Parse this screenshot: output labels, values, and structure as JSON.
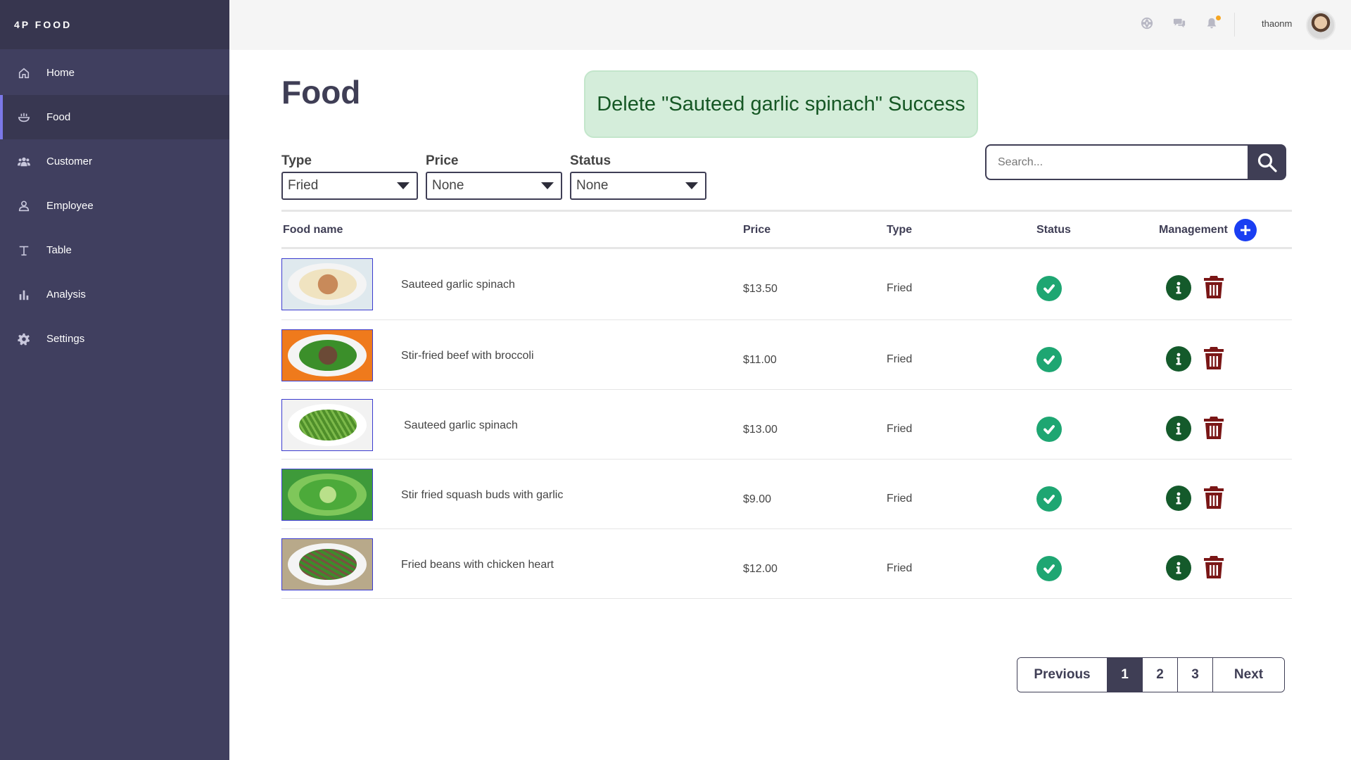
{
  "brand": "4P FOOD",
  "sidebar": {
    "items": [
      {
        "label": "Home",
        "icon": "home-icon"
      },
      {
        "label": "Food",
        "icon": "bowl-icon",
        "active": true
      },
      {
        "label": "Customer",
        "icon": "users-icon"
      },
      {
        "label": "Employee",
        "icon": "user-icon"
      },
      {
        "label": "Table",
        "icon": "table-icon"
      },
      {
        "label": "Analysis",
        "icon": "bar-chart-icon"
      },
      {
        "label": "Settings",
        "icon": "gear-icon"
      }
    ]
  },
  "topbar": {
    "icons": [
      "globe-icon",
      "chat-icon",
      "bell-icon"
    ],
    "username": "thaonm"
  },
  "page": {
    "title": "Food",
    "toast": "Delete \"Sauteed garlic spinach\" Success"
  },
  "filters": {
    "type": {
      "label": "Type",
      "value": "Fried"
    },
    "price": {
      "label": "Price",
      "value": "None"
    },
    "status": {
      "label": "Status",
      "value": "None"
    }
  },
  "search": {
    "placeholder": "Search..."
  },
  "table": {
    "headers": {
      "name": "Food name",
      "price": "Price",
      "type": "Type",
      "status": "Status",
      "management": "Management"
    },
    "rows": [
      {
        "name": "Sauteed garlic spinach",
        "price": "$13.50",
        "type": "Fried",
        "status": "available"
      },
      {
        "name": "Stir-fried beef with broccoli",
        "price": "$11.00",
        "type": "Fried",
        "status": "available"
      },
      {
        "name": "Sauteed garlic spinach",
        "price": "$13.00",
        "type": "Fried",
        "status": "available"
      },
      {
        "name": "Stir fried squash buds with garlic",
        "price": "$9.00",
        "type": "Fried",
        "status": "available"
      },
      {
        "name": "Fried beans with chicken heart",
        "price": "$12.00",
        "type": "Fried",
        "status": "available"
      }
    ]
  },
  "pagination": {
    "previous": "Previous",
    "pages": [
      "1",
      "2",
      "3"
    ],
    "current": "1",
    "next": "Next"
  },
  "colors": {
    "sidebar": "#403f5f",
    "accent": "#3f3e55",
    "toast_bg": "#d4edda",
    "toast_text": "#155724",
    "status_ok": "#1ea672",
    "info": "#145a2b",
    "delete": "#7a1616",
    "add": "#1a3ef2"
  }
}
